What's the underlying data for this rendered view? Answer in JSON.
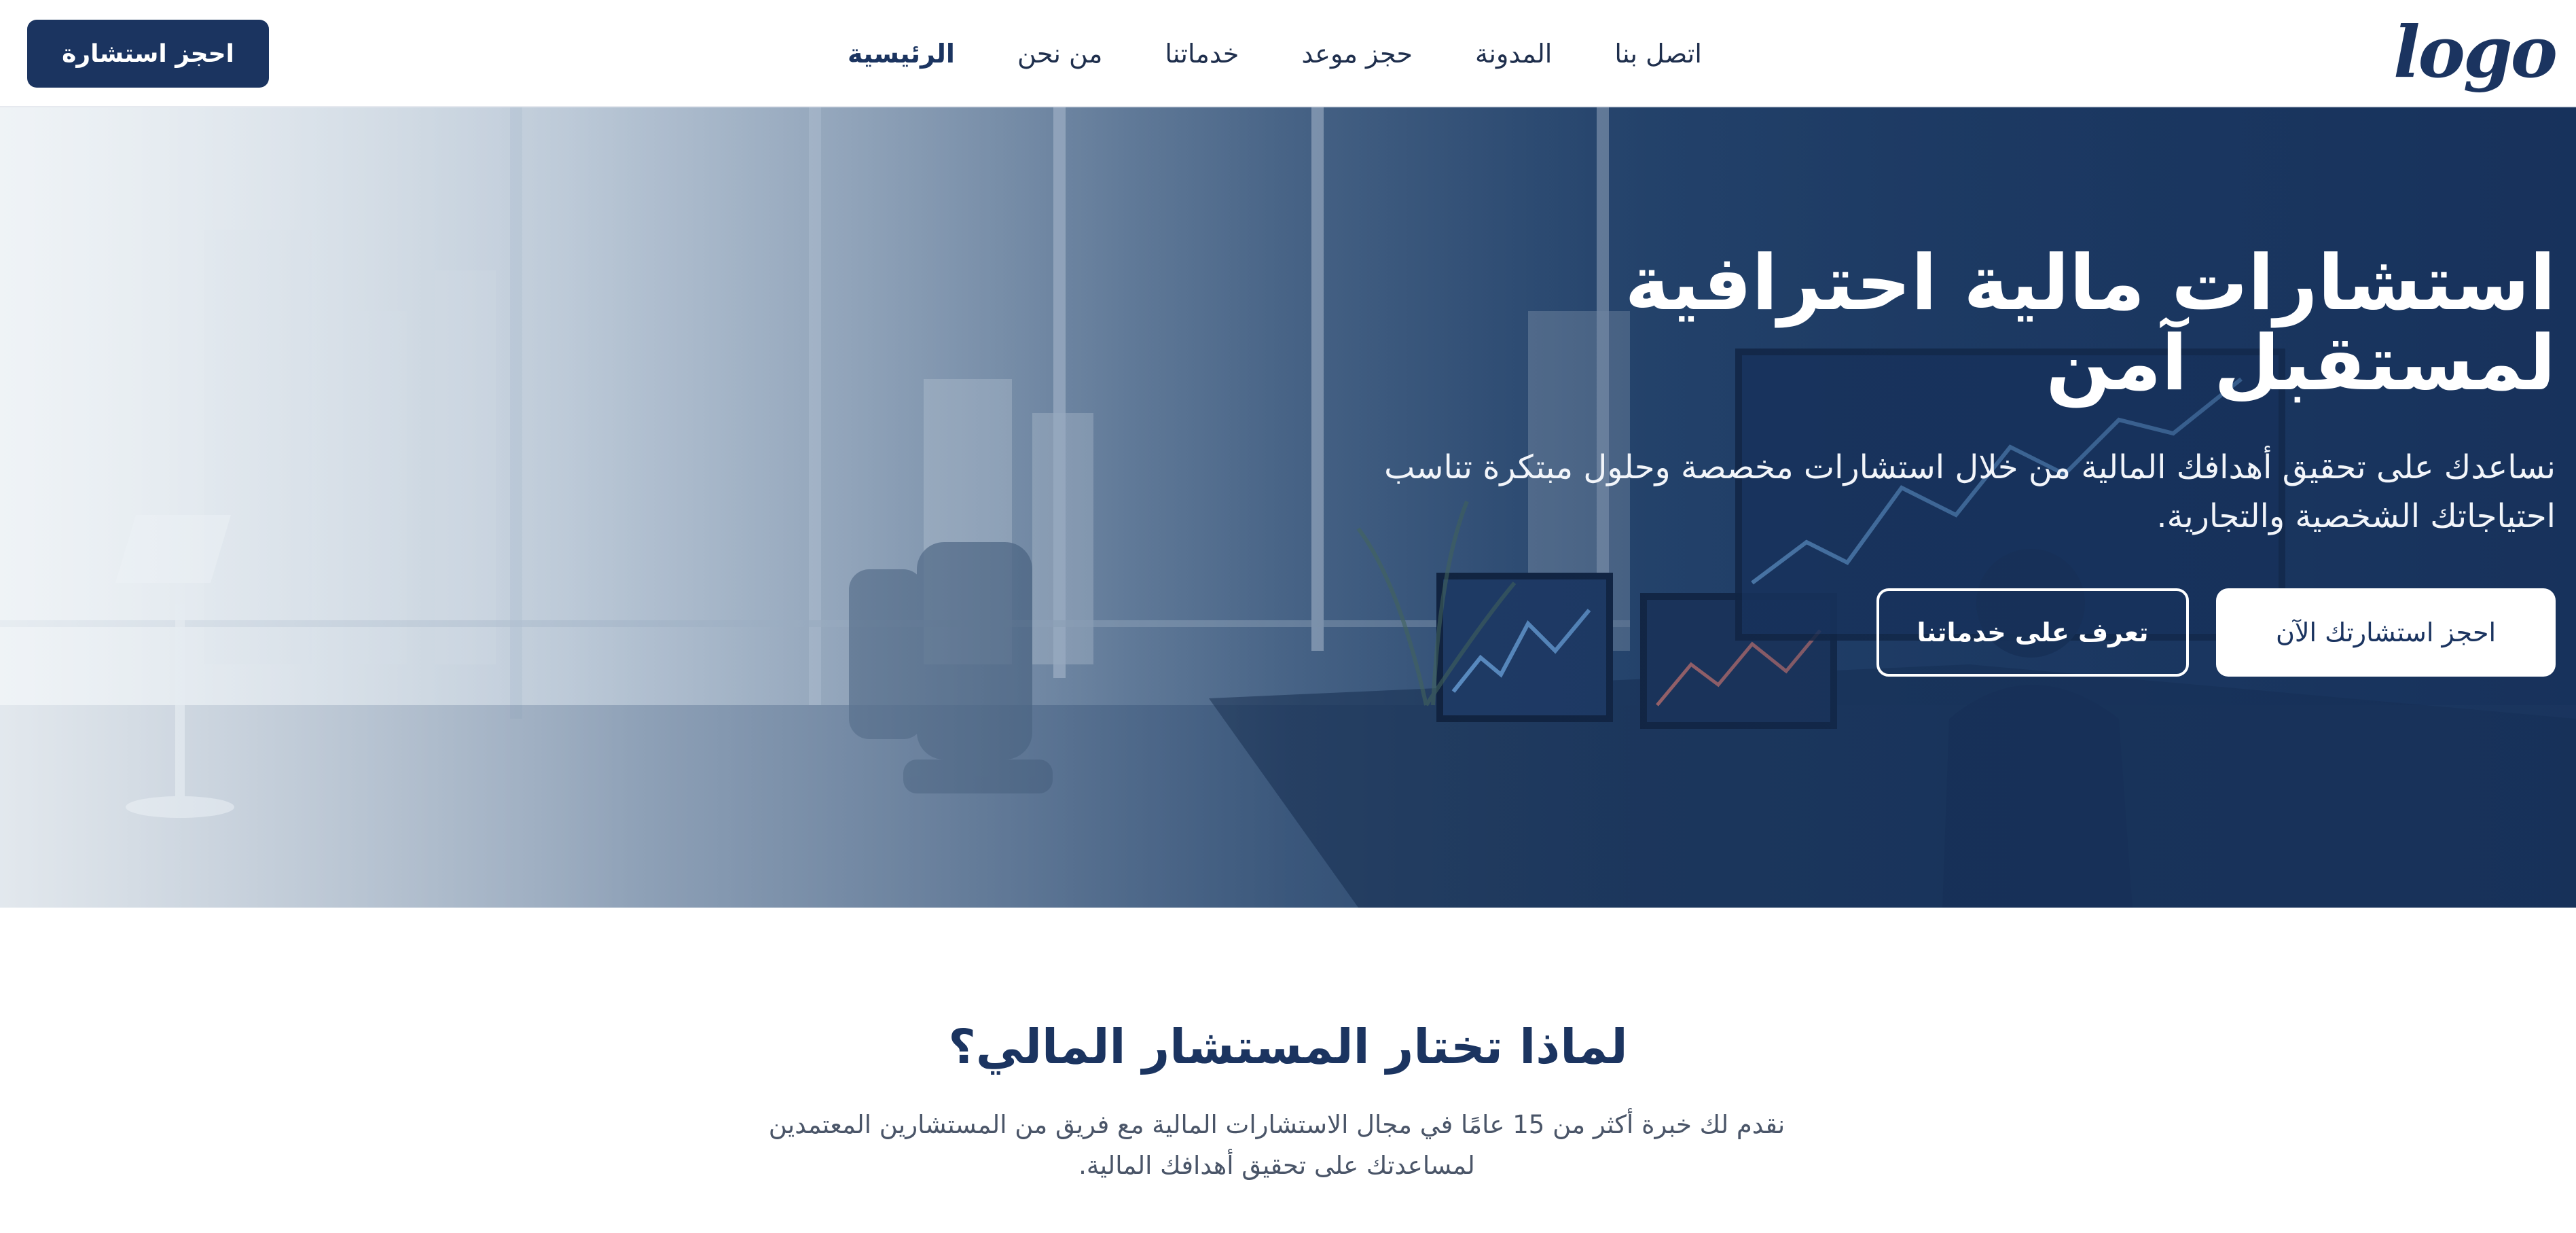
{
  "header": {
    "logo_text": "logo",
    "nav": [
      {
        "label": "الرئيسية",
        "active": true
      },
      {
        "label": "من نحن"
      },
      {
        "label": "خدماتنا"
      },
      {
        "label": "حجز موعد"
      },
      {
        "label": "المدونة"
      },
      {
        "label": "اتصل بنا"
      }
    ],
    "cta_label": "احجز استشارة"
  },
  "hero": {
    "title": "استشارات مالية احترافية لمستقبل آمن",
    "subtitle": "نساعدك على تحقيق أهدافك المالية من خلال استشارات مخصصة وحلول مبتكرة تناسب احتياجاتك الشخصية والتجارية.",
    "primary_button": "احجز استشارتك الآن",
    "secondary_button": "تعرف على خدماتنا",
    "background_image": "office-with-financial-charts-photo"
  },
  "why": {
    "title": "لماذا تختار المستشار المالي؟",
    "text": "نقدم لك خبرة أكثر من 15 عامًا في مجال الاستشارات المالية مع فريق من المستشارين المعتمدين لمساعدتك على تحقيق أهدافك المالية."
  },
  "colors": {
    "brand": "#1b3460",
    "hero_dark": "#1a3660",
    "white": "#ffffff"
  }
}
